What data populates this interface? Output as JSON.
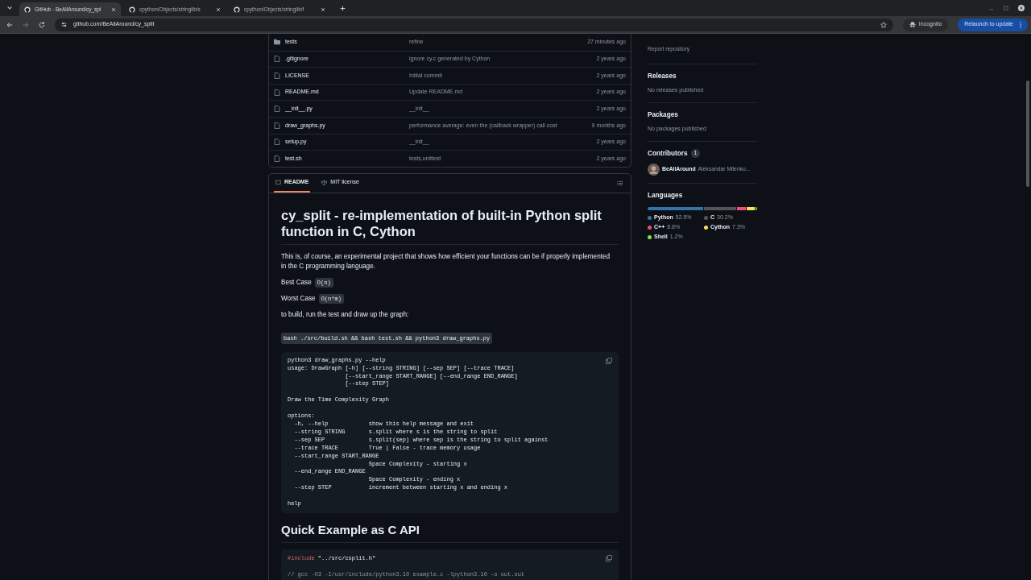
{
  "browser": {
    "tabs": [
      {
        "title": "GitHub - BeAllAround/cy_spl",
        "selected": true
      },
      {
        "title": "cpython/Objects/stringlib/s",
        "selected": false
      },
      {
        "title": "cpython/Objects/stringlib/f",
        "selected": false
      }
    ],
    "url": "github.com/BeAllAround/cy_split",
    "incognito_label": "Incognito",
    "relaunch_label": "Relaunch to update"
  },
  "files": [
    {
      "kind": "folder",
      "name": "tests",
      "message": "refine",
      "age": "27 minutes ago"
    },
    {
      "kind": "file",
      "name": ".gitignore",
      "message": "ignore cy.c generated by Cython",
      "age": "2 years ago"
    },
    {
      "kind": "file",
      "name": "LICENSE",
      "message": "Initial commit",
      "age": "2 years ago"
    },
    {
      "kind": "file",
      "name": "README.md",
      "message": "Update README.md",
      "age": "2 years ago"
    },
    {
      "kind": "file",
      "name": "__init__.py",
      "message": "__init__",
      "age": "2 years ago"
    },
    {
      "kind": "file",
      "name": "draw_graphs.py",
      "message": "performance average: even the (callback wrapper) call cost",
      "age": "9 months ago"
    },
    {
      "kind": "file",
      "name": "setup.py",
      "message": "__init__",
      "age": "2 years ago"
    },
    {
      "kind": "file",
      "name": "test.sh",
      "message": "tests,unittest",
      "age": "2 years ago"
    }
  ],
  "readme": {
    "tabs": [
      {
        "label": "README",
        "selected": true
      },
      {
        "label": "MIT license",
        "selected": false
      }
    ],
    "blocks": [
      {
        "kind": "h1",
        "text": "cy_split - re-implementation of built-in Python split function in C, Cython"
      },
      {
        "kind": "p",
        "text": "This is, of course, an experimental project that shows how efficient your functions can be if properly implemented in the C programming language."
      },
      {
        "kind": "pcode",
        "text": "Best Case",
        "code": "O(n)"
      },
      {
        "kind": "pcode",
        "text": "Worst Case",
        "code": "O(n*m)"
      },
      {
        "kind": "p",
        "text": "to build, run the test and draw up the graph:"
      },
      {
        "kind": "inline",
        "code": "bash ./src/build.sh && bash test.sh && python3 draw_graphs.py"
      },
      {
        "kind": "pre",
        "code": "python3 draw_graphs.py --help\nusage: DrawGraph [-h] [--string STRING] [--sep SEP] [--trace TRACE]\n                 [--start_range START_RANGE] [--end_range END_RANGE]\n                 [--step STEP]\n\nDraw the Time Complexity Graph\n\noptions:\n  -h, --help            show this help message and exit\n  --string STRING       s.split where s is the string to split\n  --sep SEP             s.split(sep) where sep is the string to split against\n  --trace TRACE         True | False - trace memory usage\n  --start_range START_RANGE\n                        Space Complexity - starting x\n  --end_range END_RANGE\n                        Space Complexity - ending x\n  --step STEP           increment between starting x and ending x\n\nhelp"
      },
      {
        "kind": "h2",
        "text": "Quick Example as C API"
      },
      {
        "kind": "cpre",
        "lines": [
          [
            {
              "text": "#include",
              "kind": "keyword"
            },
            {
              "text": " \"../src/csplit.h\"",
              "kind": "plain"
            }
          ],
          [
            {
              "text": "// gcc -O3 -I/usr/include/python3.10 example.c -lpython3.10 -o out.out",
              "kind": "comment"
            }
          ]
        ]
      }
    ]
  },
  "sidebar": {
    "report": "Report repository",
    "sections": [
      {
        "title": "Releases",
        "note": "No releases published"
      },
      {
        "title": "Packages",
        "note": "No packages published"
      }
    ],
    "contributors": {
      "title": "Contributors",
      "count": "1",
      "people": [
        {
          "login": "BeAllAround",
          "name": "Aleksandar Milenko..."
        }
      ]
    },
    "languages": {
      "title": "Languages",
      "items": [
        {
          "name": "Python",
          "percent": "52.5%",
          "color": "#3572a5"
        },
        {
          "name": "C",
          "percent": "30.2%",
          "color": "#555555"
        },
        {
          "name": "C++",
          "percent": "8.8%",
          "color": "#f34b7d"
        },
        {
          "name": "Cython",
          "percent": "7.3%",
          "color": "#fedf5b"
        },
        {
          "name": "Shell",
          "percent": "1.2%",
          "color": "#89e051"
        }
      ]
    }
  }
}
